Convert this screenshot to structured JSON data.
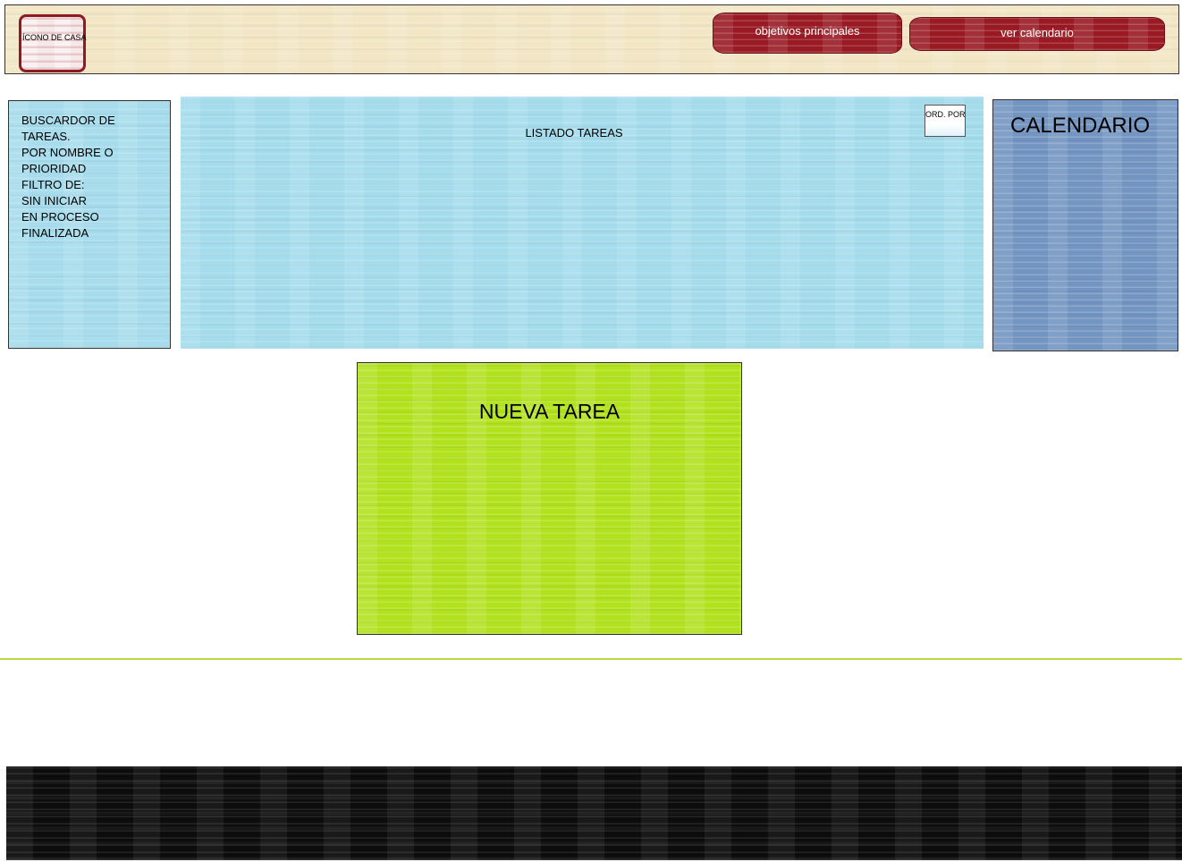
{
  "header": {
    "home_icon_label": "ÍCONO DE CASA",
    "buttons": {
      "main_objectives": "objetivos principales",
      "view_calendar": "ver calendario"
    }
  },
  "search_panel": {
    "lines": [
      "BUSCARDOR DE",
      "TAREAS.",
      "POR NOMBRE O",
      "PRIORIDAD",
      "FILTRO DE:",
      "SIN INICIAR",
      "EN PROCESO",
      "FINALIZADA"
    ]
  },
  "task_list": {
    "title": "LISTADO TAREAS",
    "sort_button": "ORD. POR"
  },
  "calendar": {
    "title": "CALENDARIO"
  },
  "new_task": {
    "title": "NUEVA TAREA"
  },
  "colors": {
    "header_bg": "#f2e6c4",
    "button_red": "#9a1a24",
    "panel_light_blue": "#a6dcec",
    "calendar_blue": "#7395c2",
    "new_task_green": "#b2e21e",
    "footer_black": "#0c0c0c"
  }
}
